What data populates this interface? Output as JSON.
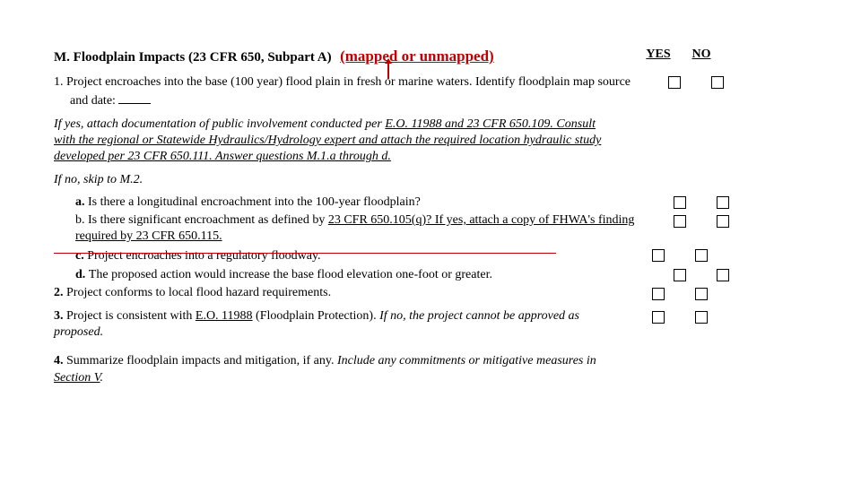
{
  "header": {
    "title": "M. Floodplain Impacts (23 CFR 650, Subpart A)",
    "mapped_note": "(mapped or unmapped)",
    "yes": "YES",
    "no": "NO"
  },
  "items": {
    "q1_lead": "1.  Project encroaches into the base (100 year) flood plain in fresh or marine waters. Identify floodplain map source and date: ",
    "ifyes_pre": "If yes, attach documentation of public involvement conducted per ",
    "ifyes_link1": "E.O. 11988 and 23 CFR 650.109. Consult with the regional or Statewide Hydraulics/Hydrology expert and attach the required location hydraulic study developed per 23 CFR 650.111. Answer questions M.1.a through d.",
    "ifno": "If no, skip to M.2.",
    "a_lead": "a. ",
    "a_text": "Is there a longitudinal encroachment into the 100-year floodplain?",
    "b_lead": "b. ",
    "b_text_pre": "Is there significant encroachment as defined by ",
    "b_link": "23 CFR 650.105(q)? If yes, attach a copy of FHWA's finding required by 23 CFR 650.115.",
    "c_lead": "c. ",
    "c_text": "Project encroaches into a regulatory floodway.",
    "d_lead": "d. ",
    "d_text": "The proposed action would increase the base flood elevation one-foot or greater.",
    "q2_lead": "2. ",
    "q2_text": "Project conforms to local flood hazard requirements.",
    "q3_lead": "3. ",
    "q3_pre": "Project is consistent with ",
    "q3_link": "E.O. 11988",
    "q3_mid": " (Floodplain Protection). ",
    "q3_ital": "If no, the project cannot be approved as proposed.",
    "q4_lead": "4. ",
    "q4_text": "Summarize floodplain impacts and mitigation, if any. ",
    "q4_ital_pre": "Include any commitments or mitigative measures in ",
    "q4_link": "Section V",
    "q4_period": "."
  }
}
